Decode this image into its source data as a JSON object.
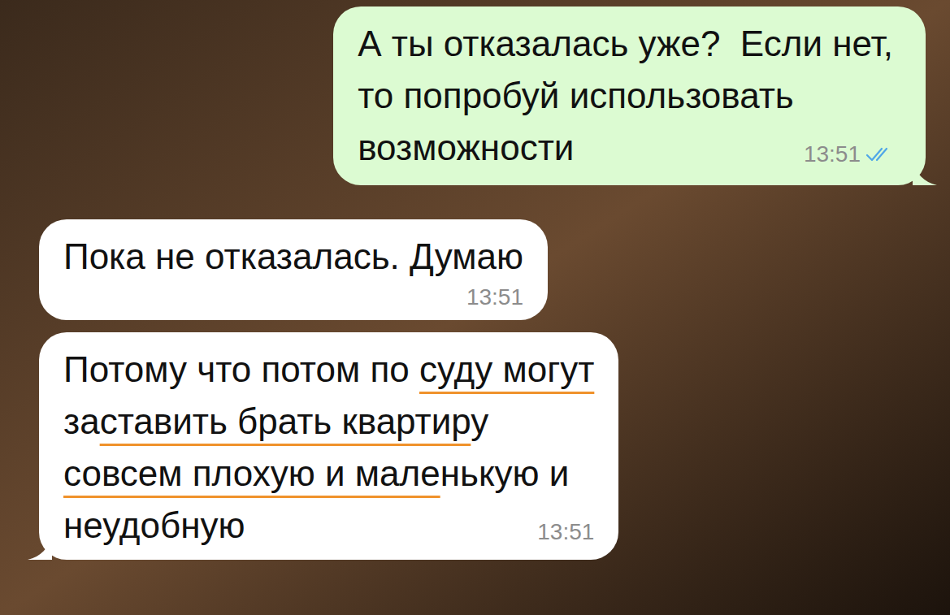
{
  "chat": {
    "messages": [
      {
        "direction": "outgoing",
        "tail": true,
        "time": "13:51",
        "read": true,
        "lines": [
          [
            {
              "text": "А ты отказалась уже?  Если нет,",
              "underlined": false
            }
          ],
          [
            {
              "text": "то попробуй использовать",
              "underlined": false
            }
          ],
          [
            {
              "text": "возможности",
              "underlined": false
            }
          ]
        ]
      },
      {
        "direction": "incoming",
        "tail": false,
        "time": "13:51",
        "read": false,
        "lines": [
          [
            {
              "text": "Пока не отказалась. Думаю",
              "underlined": false
            }
          ]
        ]
      },
      {
        "direction": "incoming",
        "tail": true,
        "time": "13:51",
        "read": false,
        "lines": [
          [
            {
              "text": "Потому что потом по ",
              "underlined": false
            },
            {
              "text": "суду могут",
              "underlined": true
            }
          ],
          [
            {
              "text": "за",
              "underlined": false
            },
            {
              "text": "ставить брать квартир",
              "underlined": true
            },
            {
              "text": "у",
              "underlined": false
            }
          ],
          [
            {
              "text": "совсем плохую и мале",
              "underlined": true
            },
            {
              "text": "нькую и",
              "underlined": false
            }
          ],
          [
            {
              "text": "неудобную",
              "underlined": false
            }
          ]
        ]
      }
    ]
  }
}
